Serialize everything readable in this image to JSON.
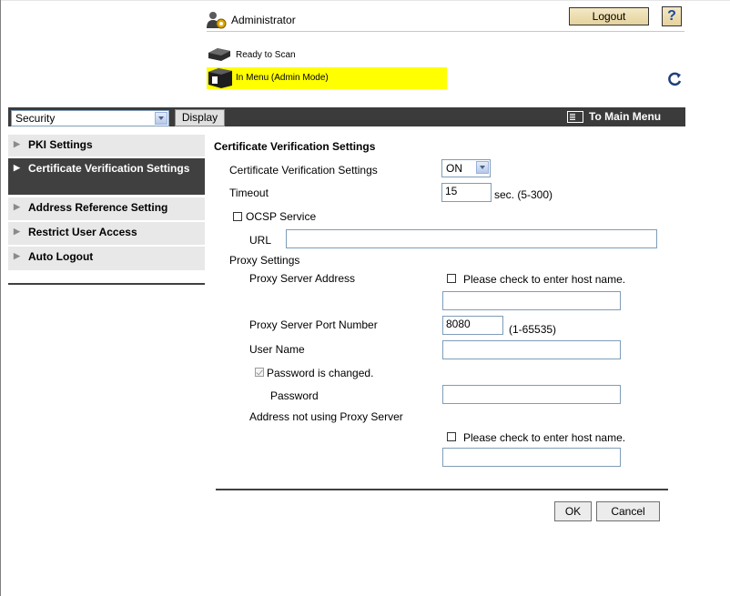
{
  "header": {
    "user_label": "Administrator",
    "logout_label": "Logout",
    "help_label": "?",
    "status_ready": "Ready to Scan",
    "status_menu": "In Menu (Admin Mode)"
  },
  "toolbar": {
    "category_value": "Security",
    "display_label": "Display",
    "main_menu_label": "To Main Menu"
  },
  "sidebar": {
    "items": [
      {
        "label": "PKI Settings"
      },
      {
        "label": "Certificate Verification Settings"
      },
      {
        "label": "Address Reference Setting"
      },
      {
        "label": "Restrict User Access"
      },
      {
        "label": "Auto Logout"
      }
    ]
  },
  "form": {
    "title": "Certificate Verification Settings",
    "cert_verify_label": "Certificate Verification Settings",
    "cert_verify_value": "ON",
    "timeout_label": "Timeout",
    "timeout_value": "15",
    "timeout_hint": "sec. (5-300)",
    "ocsp_label": "OCSP Service",
    "url_label": "URL",
    "url_value": "",
    "proxy_settings_label": "Proxy Settings",
    "proxy_address_label": "Proxy Server Address",
    "host_check_label": "Please check to enter host name.",
    "proxy_address_value": "",
    "proxy_port_label": "Proxy Server Port Number",
    "proxy_port_value": "8080",
    "proxy_port_hint": "(1-65535)",
    "username_label": "User Name",
    "username_value": "",
    "password_changed_label": "Password is changed.",
    "password_label": "Password",
    "password_value": "",
    "no_proxy_label": "Address not using Proxy Server",
    "no_proxy_check_label": "Please check to enter host name.",
    "no_proxy_value": ""
  },
  "buttons": {
    "ok": "OK",
    "cancel": "Cancel"
  },
  "colors": {
    "toolbar_bg": "#3b3b3b",
    "status_highlight": "#ffff00",
    "sidebar_active": "#404040",
    "sidebar_bg": "#e8e8e8"
  }
}
